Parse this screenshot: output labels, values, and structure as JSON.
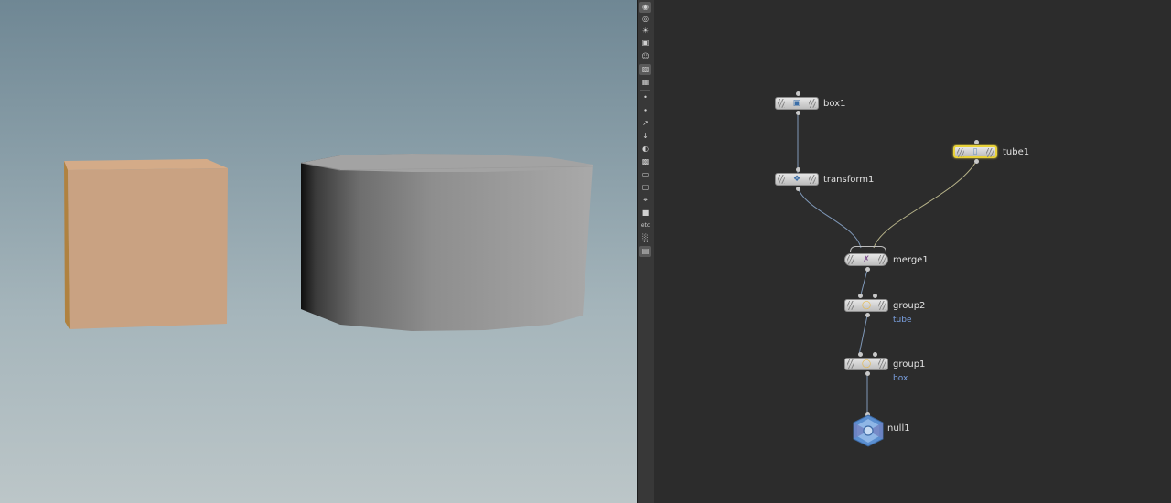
{
  "viewport": {
    "objects": [
      "box",
      "tube"
    ],
    "colors": {
      "box": "#c9a282",
      "tube": "#a8a8a8"
    }
  },
  "toolbar": {
    "tools": [
      "display-options-icon",
      "visibility-icon",
      "light-icon",
      "camera-icon",
      "ghost-icon",
      "snapshot-icon",
      "template-icon",
      "point-icon",
      "vertex-icon",
      "normal-icon",
      "uv-icon",
      "shading-icon",
      "texture-icon",
      "bounding-box-icon",
      "wireframe-icon",
      "selection-icon",
      "solid-icon",
      "background-icon",
      "viewport-layout-icon",
      "camera-view-icon"
    ],
    "text_button": "etc"
  },
  "network": {
    "wire_color": "#7f98b8",
    "selected_wire_color": "#b8b48a",
    "nodes": [
      {
        "id": "box1",
        "label": "box1",
        "icon": "box-icon",
        "selected": false
      },
      {
        "id": "transform1",
        "label": "transform1",
        "icon": "transform-icon",
        "selected": false
      },
      {
        "id": "tube1",
        "label": "tube1",
        "icon": "tube-icon",
        "selected": true
      },
      {
        "id": "merge1",
        "label": "merge1",
        "icon": "merge-icon",
        "selected": false
      },
      {
        "id": "group2",
        "label": "group2",
        "icon": "group-icon",
        "comment": "tube",
        "selected": false
      },
      {
        "id": "group1",
        "label": "group1",
        "icon": "group-icon",
        "comment": "box",
        "selected": false
      },
      {
        "id": "null1",
        "label": "null1",
        "icon": "null-icon",
        "selected": false
      }
    ]
  }
}
